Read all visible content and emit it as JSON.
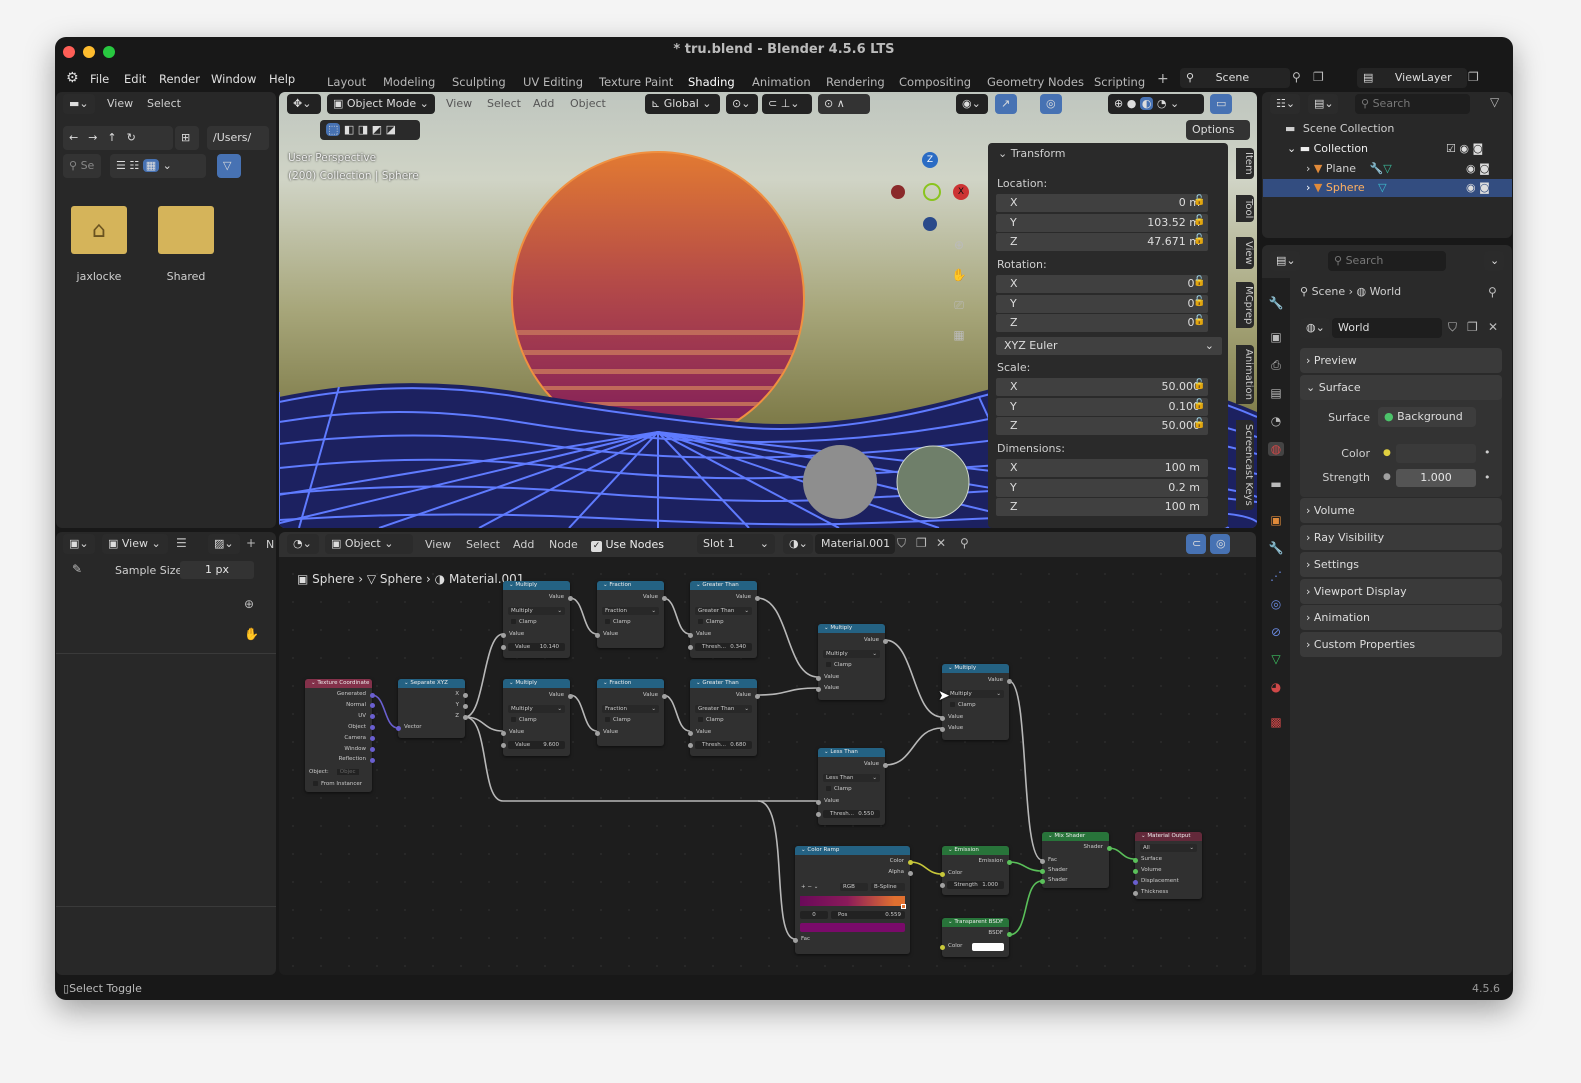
{
  "window": {
    "title": "* tru.blend - Blender 4.5.6 LTS"
  },
  "menu": [
    "File",
    "Edit",
    "Render",
    "Window",
    "Help"
  ],
  "workspaces": [
    "Layout",
    "Modeling",
    "Sculpting",
    "UV Editing",
    "Texture Paint",
    "Shading",
    "Animation",
    "Rendering",
    "Compositing",
    "Geometry Nodes",
    "Scripting"
  ],
  "active_workspace": "Shading",
  "scene": {
    "name": "Scene",
    "view_layer": "ViewLayer"
  },
  "file_browser": {
    "menu": [
      "View",
      "Select"
    ],
    "path": "/Users/",
    "search_placeholder": "Se",
    "items": [
      {
        "name": "jaxlocke",
        "icon": "home-folder-icon"
      },
      {
        "name": "Shared",
        "icon": "folder-icon"
      }
    ]
  },
  "viewport": {
    "mode": "Object Mode",
    "menu": [
      "View",
      "Select",
      "Add",
      "Object"
    ],
    "orientation": "Global",
    "overlay_line1": "User Perspective",
    "overlay_line2": "(200) Collection | Sphere",
    "options": "Options",
    "gizmo": {
      "z": "Z",
      "x": "X"
    },
    "colors": {
      "sun_top": "#e27a32",
      "sun_bottom": "#7c1a5c",
      "grid": "#5f7bff"
    }
  },
  "transform": {
    "title": "Transform",
    "location_label": "Location:",
    "location": [
      [
        "X",
        "0 m"
      ],
      [
        "Y",
        "103.52 m"
      ],
      [
        "Z",
        "47.671 m"
      ]
    ],
    "rotation_label": "Rotation:",
    "rotation": [
      [
        "X",
        "0°"
      ],
      [
        "Y",
        "0°"
      ],
      [
        "Z",
        "0°"
      ]
    ],
    "rotation_mode": "XYZ Euler",
    "scale_label": "Scale:",
    "scale": [
      [
        "X",
        "50.000"
      ],
      [
        "Y",
        "0.100"
      ],
      [
        "Z",
        "50.000"
      ]
    ],
    "dimensions_label": "Dimensions:",
    "dimensions": [
      [
        "X",
        "100 m"
      ],
      [
        "Y",
        "0.2 m"
      ],
      [
        "Z",
        "100 m"
      ]
    ]
  },
  "sidebar_tabs": [
    "Item",
    "Tool",
    "View",
    "MCprep",
    "Animation",
    "Screencast Keys"
  ],
  "outliner": {
    "search_placeholder": "Search",
    "scene_collection": "Scene Collection",
    "collection": "Collection",
    "objects": [
      {
        "name": "Plane",
        "selected": false
      },
      {
        "name": "Sphere",
        "selected": true
      }
    ]
  },
  "properties": {
    "search_placeholder": "Search",
    "breadcrumb": [
      "Scene",
      "World"
    ],
    "world": "World",
    "panels": {
      "preview": "Preview",
      "surface": "Surface",
      "volume": "Volume",
      "ray_visibility": "Ray Visibility",
      "settings": "Settings",
      "viewport_display": "Viewport Display",
      "animation": "Animation",
      "custom_properties": "Custom Properties"
    },
    "surface_label": "Surface",
    "surface_value": "Background",
    "color_label": "Color",
    "color_value": "#3a3a3a",
    "strength_label": "Strength",
    "strength_value": "1.000"
  },
  "tool_panel": {
    "sample_size_label": "Sample Size",
    "sample_size_value": "1 px"
  },
  "node_editor": {
    "header": {
      "view": "View",
      "object": "Object",
      "menu": [
        "View",
        "Select",
        "Add",
        "Node"
      ],
      "use_nodes": "Use Nodes",
      "slot": "Slot 1",
      "material": "Material.001"
    },
    "breadcrumb": [
      "Sphere",
      "Sphere",
      "Material.001"
    ],
    "nodes": {
      "texcoord": {
        "title": "Texture Coordinate",
        "outputs": [
          "Generated",
          "Normal",
          "UV",
          "Object",
          "Camera",
          "Window",
          "Reflection"
        ],
        "object_label": "Object:",
        "object_placeholder": "Objec",
        "from_instancer": "From Instancer"
      },
      "sepxyz": {
        "title": "Separate XYZ",
        "outputs": [
          "X",
          "Y",
          "Z"
        ],
        "input": "Vector"
      },
      "mul1": {
        "title": "Multiply",
        "out": "Value",
        "op": "Multiply",
        "clamp": "Clamp",
        "in": "Value",
        "field_label": "Value",
        "field_value": "10.140"
      },
      "frac1": {
        "title": "Fraction",
        "out": "Value",
        "op": "Fraction",
        "clamp": "Clamp",
        "in": "Value"
      },
      "gt1": {
        "title": "Greater Than",
        "out": "Value",
        "op": "Greater Than",
        "clamp": "Clamp",
        "in": "Value",
        "field_label": "Thresh...",
        "field_value": "0.340"
      },
      "mul2": {
        "title": "Multiply",
        "out": "Value",
        "op": "Multiply",
        "clamp": "Clamp",
        "in": "Value",
        "field_label": "Value",
        "field_value": "9.600"
      },
      "frac2": {
        "title": "Fraction",
        "out": "Value",
        "op": "Fraction",
        "clamp": "Clamp",
        "in": "Value"
      },
      "gt2": {
        "title": "Greater Than",
        "out": "Value",
        "op": "Greater Than",
        "clamp": "Clamp",
        "in": "Value",
        "field_label": "Thresh...",
        "field_value": "0.680"
      },
      "mul3": {
        "title": "Multiply",
        "out": "Value",
        "op": "Multiply",
        "clamp": "Clamp",
        "in1": "Value",
        "in2": "Value"
      },
      "lt": {
        "title": "Less Than",
        "out": "Value",
        "op": "Less Than",
        "clamp": "Clamp",
        "in": "Value",
        "field_label": "Thresh...",
        "field_value": "0.550"
      },
      "mul4": {
        "title": "Multiply",
        "out": "Value",
        "op": "Multiply",
        "clamp": "Clamp",
        "in1": "Value",
        "in2": "Value"
      },
      "ramp": {
        "title": "Color Ramp",
        "out1": "Color",
        "out2": "Alpha",
        "mode": "RGB",
        "interp": "B-Spline",
        "index": "0",
        "pos_label": "Pos",
        "pos_value": "0.559",
        "in": "Fac"
      },
      "emission": {
        "title": "Emission",
        "out": "Emission",
        "in": "Color",
        "strength_label": "Strength",
        "strength_value": "1.000"
      },
      "transparent": {
        "title": "Transparent BSDF",
        "out": "BSDF",
        "in": "Color"
      },
      "mix": {
        "title": "Mix Shader",
        "out": "Shader",
        "in": [
          "Fac",
          "Shader",
          "Shader"
        ]
      },
      "output": {
        "title": "Material Output",
        "target": "All",
        "in": [
          "Surface",
          "Volume",
          "Displacement",
          "Thickness"
        ]
      }
    }
  },
  "status": {
    "left": "Select Toggle",
    "version": "4.5.6"
  }
}
